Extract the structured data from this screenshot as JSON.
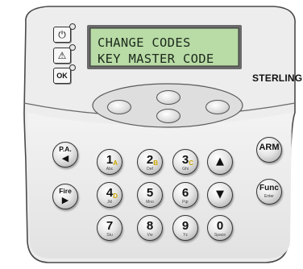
{
  "display": {
    "line1": "CHANGE CODES",
    "line2": "KEY MASTER CODE"
  },
  "brand": "STERLING",
  "indicators": [
    {
      "icon": "power-icon",
      "glyph": "⏻"
    },
    {
      "icon": "warning-icon",
      "glyph": "⚠"
    },
    {
      "icon": "ok-icon",
      "glyph": "OK"
    }
  ],
  "keys": {
    "pa": {
      "label": "P.A.",
      "arrow": "◀"
    },
    "fire": {
      "label": "Fire",
      "arrow": "▶"
    },
    "arm": {
      "label": "ARM"
    },
    "func": {
      "label": "Func",
      "sub": "Enter"
    },
    "up": {
      "glyph": "▲"
    },
    "down": {
      "glyph": "▼"
    },
    "digits": [
      {
        "num": "1",
        "sub": "Abc",
        "acc": "A"
      },
      {
        "num": "2",
        "sub": "Def",
        "acc": "B"
      },
      {
        "num": "3",
        "sub": "Ghi",
        "acc": "C"
      },
      {
        "num": "4",
        "sub": "Jkl",
        "acc": "D"
      },
      {
        "num": "5",
        "sub": "Mno",
        "acc": ""
      },
      {
        "num": "6",
        "sub": "Pqr",
        "acc": ""
      },
      {
        "num": "7",
        "sub": "Stu",
        "acc": ""
      },
      {
        "num": "8",
        "sub": "Vw",
        "acc": ""
      },
      {
        "num": "9",
        "sub": "Yz",
        "acc": ""
      },
      {
        "num": "0",
        "sub": "Space",
        "acc": ""
      }
    ]
  },
  "colors": {
    "lcd": "#b9dba6",
    "panel": "#ececec",
    "accent": "#c9a600"
  }
}
